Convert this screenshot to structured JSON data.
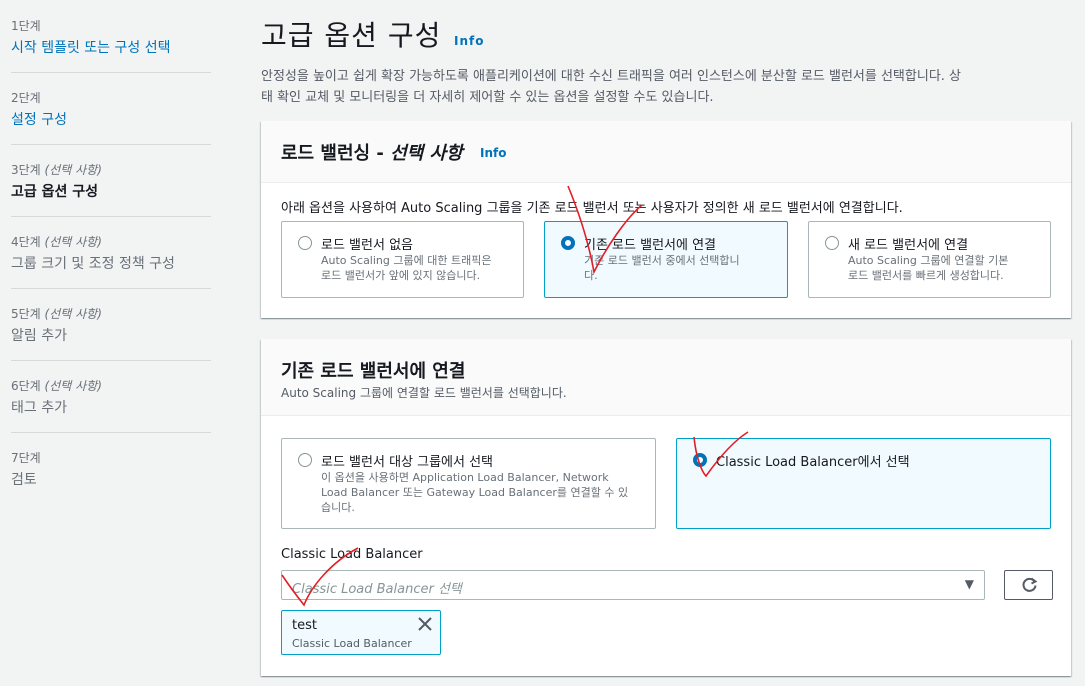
{
  "sidebar": {
    "steps": [
      {
        "num": "1단계",
        "optional": "",
        "title": "시작 템플릿 또는 구성 선택"
      },
      {
        "num": "2단계",
        "optional": "",
        "title": "설정 구성"
      },
      {
        "num": "3단계",
        "optional": "(선택 사항)",
        "title": "고급 옵션 구성"
      },
      {
        "num": "4단계",
        "optional": "(선택 사항)",
        "title": "그룹 크기 및 조정 정책 구성"
      },
      {
        "num": "5단계",
        "optional": "(선택 사항)",
        "title": "알림 추가"
      },
      {
        "num": "6단계",
        "optional": "(선택 사항)",
        "title": "태그 추가"
      },
      {
        "num": "7단계",
        "optional": "",
        "title": "검토"
      }
    ]
  },
  "page": {
    "title": "고급 옵션 구성",
    "info": "Info",
    "description_line1": "안정성을 높이고 쉽게 확장 가능하도록 애플리케이션에 대한 수신 트래픽을 여러 인스턴스에 분산할 로드 밸런서를 선택합니다. 상",
    "description_line2": "태 확인 교체 및 모니터링을 더 자세히 제어할 수 있는 옵션을 설정할 수도 있습니다."
  },
  "lb_panel": {
    "title": "로드 밸런싱 - ",
    "title_optional": "선택 사항",
    "info": "Info",
    "description": "아래 옵션을 사용하여 Auto Scaling 그룹을 기존 로드 밸런서 또는 사용자가 정의한 새 로드 밸런서에 연결합니다.",
    "options": [
      {
        "label": "로드 밸런서 없음",
        "desc1": "Auto Scaling 그룹에 대한 트래픽은",
        "desc2": "로드 밸런서가 앞에 있지 않습니다."
      },
      {
        "label": "기존 로드 밸런서에 연결",
        "desc1": "기존 로드 밸런서 중에서 선택합니",
        "desc2": "다."
      },
      {
        "label": "새 로드 밸런서에 연결",
        "desc1": "Auto Scaling 그룹에 연결할 기본",
        "desc2": "로드 밸런서를 빠르게 생성합니다."
      }
    ]
  },
  "attach_panel": {
    "title": "기존 로드 밸런서에 연결",
    "subtitle": "Auto Scaling 그룹에 연결할 로드 밸런서를 선택합니다.",
    "options": [
      {
        "label": "로드 밸런서 대상 그룹에서 선택",
        "desc1": "이 옵션을 사용하면 Application Load Balancer, Network",
        "desc2": "Load Balancer 또는 Gateway Load Balancer를 연결할 수 있",
        "desc3": "습니다."
      },
      {
        "label": "Classic Load Balancer에서 선택"
      }
    ],
    "field_label": "Classic Load Balancer",
    "select_placeholder": "Classic Load Balancer 선택",
    "token": {
      "name": "test",
      "type": "Classic Load Balancer"
    }
  },
  "colors": {
    "accent": "#0073bb",
    "selected_border": "#00a1c9",
    "annotation": "#e31e24"
  }
}
